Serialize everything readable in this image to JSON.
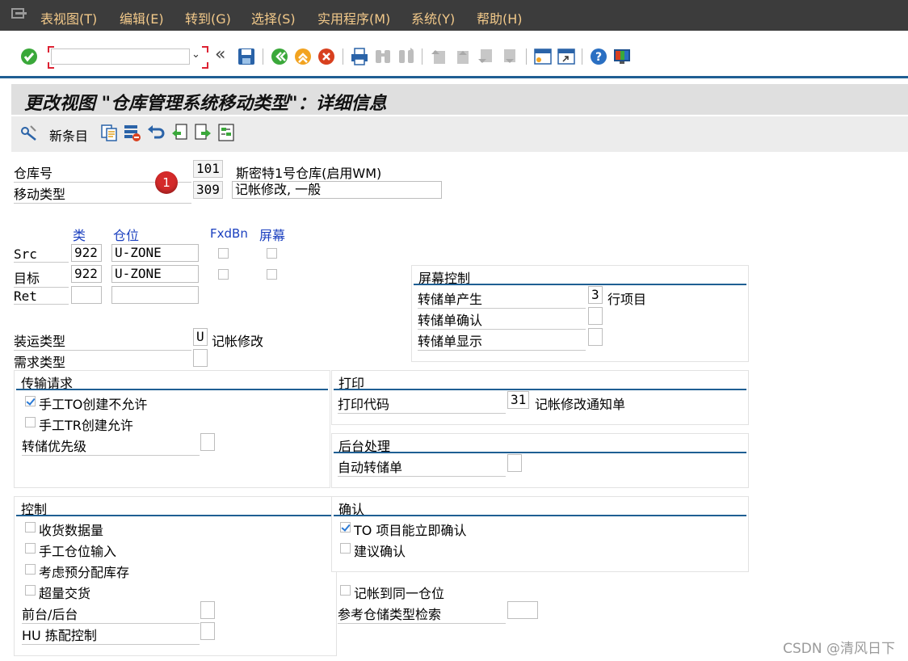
{
  "menu": [
    "表视图(T)",
    "编辑(E)",
    "转到(G)",
    "选择(S)",
    "实用程序(M)",
    "系统(Y)",
    "帮助(H)"
  ],
  "command_field": {
    "value": "",
    "placeholder": ""
  },
  "back_glyph": "«",
  "title": "更改视图 \"仓库管理系统移动类型\"：详细信息",
  "app_toolbar": {
    "new_entries": "新条目"
  },
  "header": {
    "warehouse_label": "仓库号",
    "warehouse_value": "101",
    "warehouse_desc": "斯密特1号仓库(启用WM)",
    "movetype_label": "移动类型",
    "movetype_value": "309",
    "movetype_desc": "记帐修改, 一般",
    "annotation_number": "1"
  },
  "bins": {
    "col_type": "类",
    "col_bin": "仓位",
    "col_fixed": "FxdBn",
    "col_screen": "屏幕",
    "rows": [
      {
        "label": "Src",
        "type": "922",
        "bin": "U-ZONE"
      },
      {
        "label": "目标",
        "type": "922",
        "bin": "U-ZONE"
      },
      {
        "label": "Ret",
        "type": "",
        "bin": ""
      }
    ]
  },
  "shipment": {
    "label": "装运类型",
    "value": "U",
    "desc": "记帐修改"
  },
  "requirement": {
    "label": "需求类型",
    "value": ""
  },
  "screen_control": {
    "title": "屏幕控制",
    "to_create_label": "转储单产生",
    "to_create_value": "3",
    "to_create_desc": "行项目",
    "to_confirm_label": "转储单确认",
    "to_confirm_value": "",
    "to_display_label": "转储单显示",
    "to_display_value": ""
  },
  "transfer_request": {
    "title": "传输请求",
    "manual_to_label": "手工TO创建不允许",
    "manual_to_checked": true,
    "manual_tr_label": "手工TR创建允许",
    "manual_tr_checked": false,
    "priority_label": "转储优先级",
    "priority_value": ""
  },
  "print": {
    "title": "打印",
    "code_label": "打印代码",
    "code_value": "31",
    "code_desc": "记帐修改通知单"
  },
  "background": {
    "title": "后台处理",
    "auto_label": "自动转储单",
    "auto_value": ""
  },
  "control": {
    "title": "控制",
    "items": [
      {
        "label": "收货数据量",
        "checked": false
      },
      {
        "label": "手工仓位输入",
        "checked": false
      },
      {
        "label": "考虑预分配库存",
        "checked": false
      },
      {
        "label": "超量交货",
        "checked": false
      }
    ],
    "fg_bg_label": "前台/后台",
    "fg_bg_value": "",
    "hu_label": "HU 拣配控制",
    "hu_value": ""
  },
  "confirm": {
    "title": "确认",
    "to_immediate_label": "TO 项目能立即确认",
    "to_immediate_checked": true,
    "propose_label": "建议确认",
    "propose_checked": false
  },
  "post_same_bin": {
    "label": "记帐到同一仓位",
    "checked": false
  },
  "ref_search": {
    "label": "参考仓储类型检索",
    "value": ""
  },
  "watermark": "CSDN @清风日下"
}
